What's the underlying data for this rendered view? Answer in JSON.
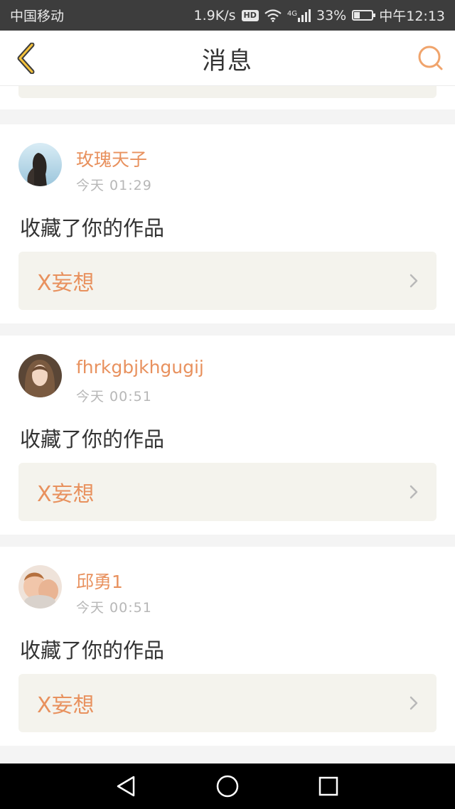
{
  "status_bar": {
    "carrier": "中国移动",
    "speed": "1.9K/s",
    "hd": "HD",
    "network": "4G",
    "battery_percent": "33%",
    "battery_level": 0.33,
    "time": "中午12:13"
  },
  "header": {
    "title": "消息",
    "back_icon": "back-chevron-icon",
    "search_icon": "search-icon"
  },
  "messages": [
    {
      "username": "玫瑰天子",
      "time": "今天 01:29",
      "action": "收藏了你的作品",
      "work_title": "X妄想"
    },
    {
      "username": "fhrkgbjkhgugij",
      "time": "今天 00:51",
      "action": "收藏了你的作品",
      "work_title": "X妄想"
    },
    {
      "username": "邱勇1",
      "time": "今天 00:51",
      "action": "收藏了你的作品",
      "work_title": "X妄想"
    }
  ],
  "colors": {
    "accent": "#e8915e",
    "card_bg": "#f4f3ed",
    "status_bar": "#3d3d3d"
  },
  "nav": {
    "back_icon": "nav-back-triangle-icon",
    "home_icon": "nav-home-circle-icon",
    "recent_icon": "nav-recent-square-icon"
  }
}
